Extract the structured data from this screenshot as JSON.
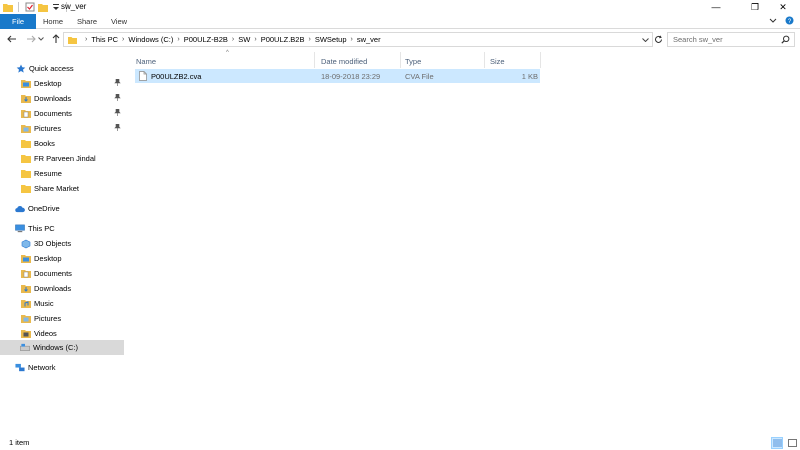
{
  "window": {
    "title": "sw_ver",
    "controls": {
      "minimize": "—",
      "maximize": "❐",
      "close": "✕"
    }
  },
  "ribbon": {
    "tabs": [
      "File",
      "Home",
      "Share",
      "View"
    ]
  },
  "address": {
    "crumbs": [
      "This PC",
      "Windows (C:)",
      "P00ULZ-B2B",
      "SW",
      "P00ULZ.B2B",
      "SWSetup",
      "sw_ver"
    ],
    "search_placeholder": "Search sw_ver"
  },
  "nav": {
    "quick_access": "Quick access",
    "quick_items": [
      "Desktop",
      "Downloads",
      "Documents",
      "Pictures",
      "Books",
      "FR Parveen Jindal",
      "Resume",
      "Share Market"
    ],
    "onedrive": "OneDrive",
    "this_pc": "This PC",
    "pc_items": [
      "3D Objects",
      "Desktop",
      "Documents",
      "Downloads",
      "Music",
      "Pictures",
      "Videos",
      "Windows (C:)"
    ],
    "network": "Network"
  },
  "columns": {
    "name": "Name",
    "date": "Date modified",
    "type": "Type",
    "size": "Size"
  },
  "files": [
    {
      "name": "P00ULZB2.cva",
      "date": "18-09-2018 23:29",
      "type": "CVA File",
      "size": "1 KB"
    }
  ],
  "status": {
    "item_count": "1 item"
  },
  "colors": {
    "accent": "#1979ca",
    "selection": "#cce8ff",
    "nav_selected": "#d9d9d9",
    "folder": "#f5c542"
  }
}
